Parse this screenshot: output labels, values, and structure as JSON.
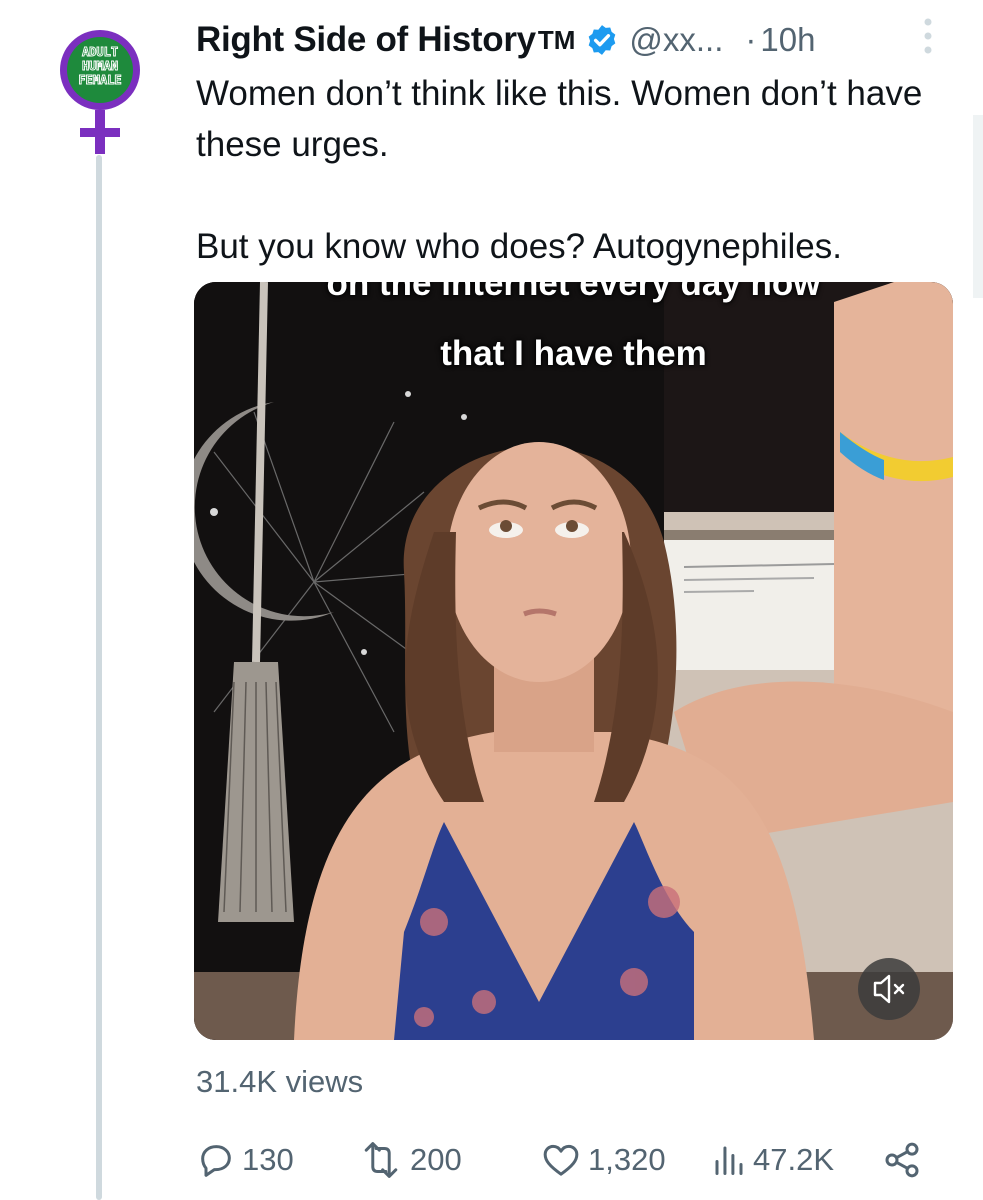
{
  "avatar": {
    "lines": [
      "ADULT",
      "HUMAN",
      "FEMALE"
    ]
  },
  "tweet": {
    "author_name": "Right Side of History",
    "author_suffix": "TM",
    "handle": "@xx...",
    "separator": "·",
    "time": "10h",
    "text_line1": "Women don’t think like this. Women don’t have these urges.",
    "text_line2": "But you know who does? Autogynephiles."
  },
  "media": {
    "caption_top": "on the internet every day now",
    "caption_main": "that I have them",
    "mute_icon": "volume-muted-icon"
  },
  "stats": {
    "views_label": "31.4K views",
    "replies": "130",
    "reposts": "200",
    "likes": "1,320",
    "views": "47.2K"
  },
  "colors": {
    "text_primary": "#0f1419",
    "text_secondary": "#536471",
    "verified_blue": "#1d9bf0",
    "avatar_purple": "#7b2fbf",
    "avatar_green": "#1e8a3c"
  }
}
